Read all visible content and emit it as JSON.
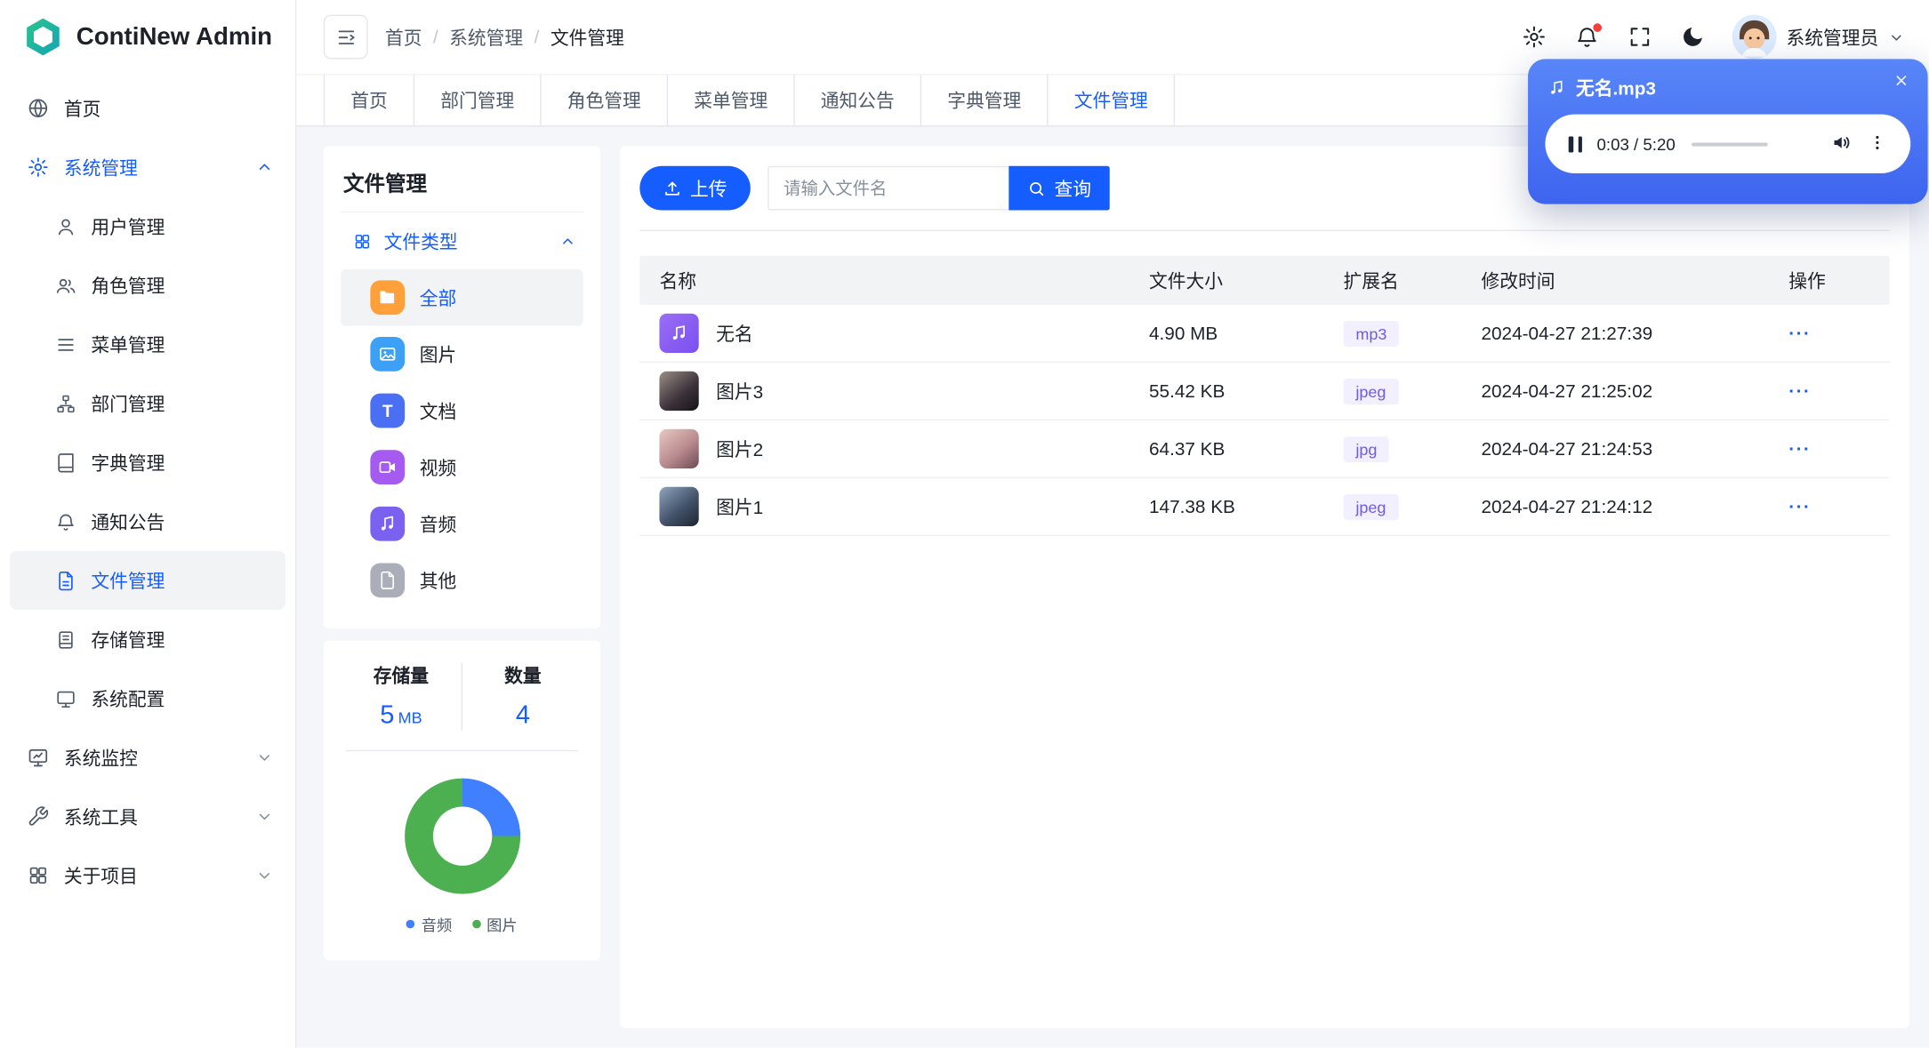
{
  "app": {
    "name": "ContiNew Admin"
  },
  "header": {
    "breadcrumb": {
      "items": [
        "首页",
        "系统管理",
        "文件管理"
      ],
      "separator": "/"
    },
    "username": "系统管理员"
  },
  "tabbar": {
    "tabs": [
      "首页",
      "部门管理",
      "角色管理",
      "菜单管理",
      "通知公告",
      "字典管理",
      "文件管理"
    ],
    "active": "文件管理"
  },
  "sidebar": {
    "home": "首页",
    "system": "系统管理",
    "system_children": [
      "用户管理",
      "角色管理",
      "菜单管理",
      "部门管理",
      "字典管理",
      "通知公告",
      "文件管理",
      "存储管理",
      "系统配置"
    ],
    "active_child": "文件管理",
    "monitor": "系统监控",
    "tools": "系统工具",
    "about": "关于项目"
  },
  "file_panel": {
    "title": "文件管理",
    "tree_root": "文件类型",
    "types": [
      "全部",
      "图片",
      "文档",
      "视频",
      "音频",
      "其他"
    ],
    "active_type": "全部",
    "stats": {
      "storage_label": "存储量",
      "storage_value": "5",
      "storage_unit": "MB",
      "count_label": "数量",
      "count_value": "4"
    }
  },
  "chart_data": {
    "type": "pie",
    "categories": [
      "音频",
      "图片"
    ],
    "values": [
      25,
      75
    ],
    "colors": [
      "#4080FF",
      "#4CAF50"
    ],
    "legend_position": "bottom",
    "donut": true
  },
  "toolbar": {
    "upload": "上传",
    "search_placeholder": "请输入文件名",
    "query": "查询"
  },
  "table": {
    "columns": [
      "名称",
      "文件大小",
      "扩展名",
      "修改时间",
      "操作"
    ],
    "rows": [
      {
        "name": "无名",
        "size": "4.90 MB",
        "ext": "mp3",
        "time": "2024-04-27 21:27:39",
        "ops": "···"
      },
      {
        "name": "图片3",
        "size": "55.42 KB",
        "ext": "jpeg",
        "time": "2024-04-27 21:25:02",
        "ops": "···"
      },
      {
        "name": "图片2",
        "size": "64.37 KB",
        "ext": "jpg",
        "time": "2024-04-27 21:24:53",
        "ops": "···"
      },
      {
        "name": "图片1",
        "size": "147.38 KB",
        "ext": "jpeg",
        "time": "2024-04-27 21:24:12",
        "ops": "···"
      }
    ]
  },
  "player": {
    "title": "无名.mp3",
    "time": "0:03 / 5:20",
    "progress_percent": 10
  },
  "glyphs": {
    "doc": "T"
  },
  "colors": {
    "primary": "#165DFF",
    "notice_dot": "#F53F3F",
    "badge_bg": "#F2EFFE",
    "badge_text": "#6E5CE6"
  }
}
